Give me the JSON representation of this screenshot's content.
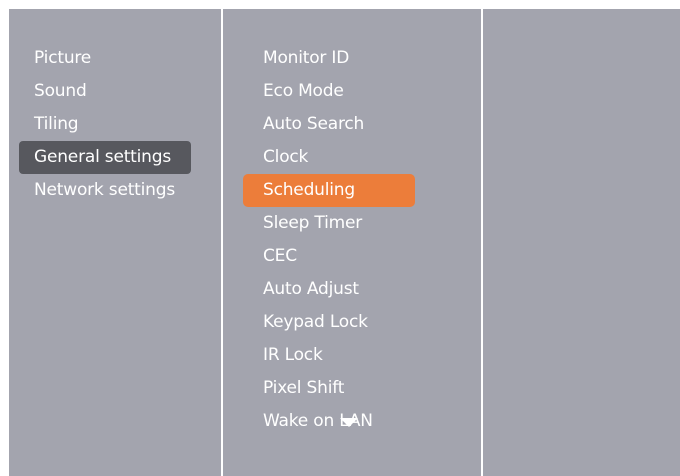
{
  "menu": {
    "categories": [
      {
        "label": "Picture"
      },
      {
        "label": "Sound"
      },
      {
        "label": "Tiling"
      },
      {
        "label": "General settings",
        "selected": true
      },
      {
        "label": "Network settings"
      }
    ],
    "general_settings_items": [
      {
        "label": "Monitor ID"
      },
      {
        "label": "Eco Mode"
      },
      {
        "label": "Auto Search"
      },
      {
        "label": "Clock"
      },
      {
        "label": "Scheduling",
        "highlighted": true
      },
      {
        "label": "Sleep Timer"
      },
      {
        "label": "CEC"
      },
      {
        "label": "Auto Adjust"
      },
      {
        "label": "Keypad Lock"
      },
      {
        "label": "IR Lock"
      },
      {
        "label": "Pixel Shift"
      },
      {
        "label": "Wake on LAN"
      }
    ],
    "more_below_icon": "chevron-down-icon"
  },
  "colors": {
    "background": "#a3a4ae",
    "selected_category": "#57585e",
    "highlight": "#ec7d3a",
    "text": "#ffffff"
  }
}
